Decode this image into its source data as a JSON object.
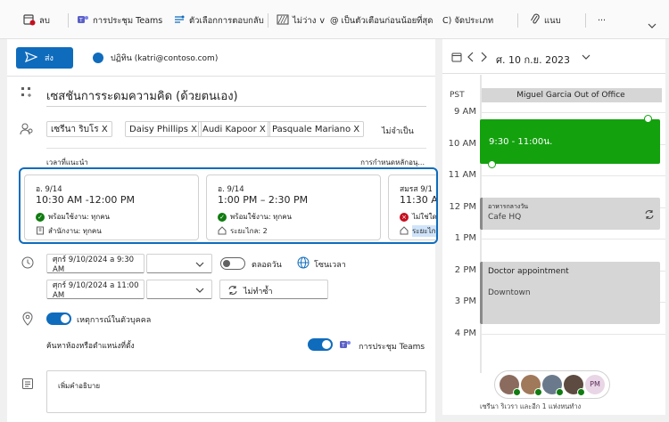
{
  "ribbon": {
    "discard": "ลบ",
    "teams": "การประชุม Teams",
    "response_options": "ตัวเลือกการตอบกลับ",
    "busy_status": "ไม่ว่าง",
    "v": "v",
    "reminder": "@ เป็นตัวเตือนก่อนน้อยที่สุด",
    "categorize": "C) จัดประเภท",
    "attach": "แนบ",
    "more": "···"
  },
  "compose": {
    "send_label": "ส่ง",
    "from": "ปฏิทิน (katri@contoso.com)",
    "title": "เซสชันการระดมความคิด (ด้วยตนเอง)",
    "attendees": [
      "เซรีนา ริบโร X",
      "Daisy Phillips X",
      "Audi Kapoor X",
      "Pasquale Mariano X"
    ],
    "optional": "ไม่จำเป็น",
    "suggested_label": "เวลาที่แนะนำ",
    "schedule_label": "การกำหนดหลักอนุ...",
    "slots": [
      {
        "date": "อ. 9/14",
        "time": "10:30 AM -12:00 PM",
        "avail": "พร้อมใช้งาน: ทุกคน",
        "loc": "สำนักงาน: ทุกคน"
      },
      {
        "date": "อ. 9/14",
        "time": "1:00 PM – 2:30 PM",
        "avail": "พร้อมใช้งาน: ทุกคน",
        "loc": "ระยะไกล: 2"
      },
      {
        "date": "สมรส 9/1",
        "time": "11:30 AM",
        "avail": "ไม่ใช่ใดนอา...",
        "loc": "ระยะไกล"
      }
    ],
    "start_date": "ศุกร์ 9/10/2024 a 9:30 AM",
    "end_date": "ศุกร์ 9/10/2024 a 11:00 AM",
    "all_day": "ตลอดวัน",
    "timezone": "โซนเวลา",
    "repeat": "ไม่ทำซ้ำ",
    "in_person": "เหตุการณ์ในตัวบุคคล",
    "location_label": "ค้นหาห้องหรือตำแหน่งที่ตั้ง",
    "teams_meeting": "การประชุม Teams",
    "description_placeholder": "เพิ่มคำอธิบาย"
  },
  "calendar": {
    "date_label": "ศ. 10 ก.ย. 2023",
    "tz": "PST",
    "ooo_banner": "Miguel Garcia Out of Office",
    "hours": [
      "9 AM",
      "10 AM",
      "11 AM",
      "12 PM",
      "1 PM",
      "2 PM",
      "3 PM",
      "4 PM"
    ],
    "event_new": "9:30 - 11:00น.",
    "event_lunch_title": "อาหารกลางวัน",
    "event_lunch_loc": "Cafe HQ",
    "event_doctor_title": "Doctor appointment",
    "event_doctor_loc": "Downtown",
    "avatar_initials": "PM",
    "attendee_summary": "เซรีนา ริเวรา และอีก 1 แห่งหนทำง"
  },
  "colors": {
    "accent": "#0f6cbd",
    "event_green": "#13a10e",
    "event_gray": "#d6d6d6",
    "available": "#107c10",
    "unavailable": "#c50f1f"
  }
}
